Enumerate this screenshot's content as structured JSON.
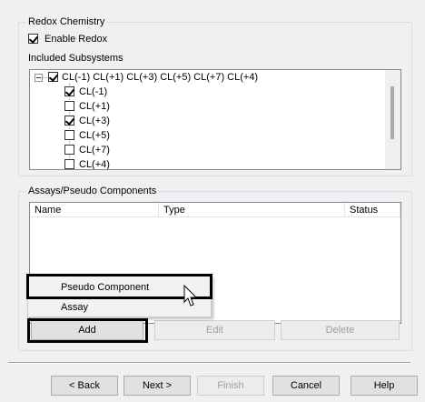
{
  "redox": {
    "group_title": "Redox Chemistry",
    "enable_label": "Enable Redox",
    "enable_checked": true,
    "included_label": "Included Subsystems",
    "tree": {
      "root_label": "CL(-1) CL(+1) CL(+3) CL(+5) CL(+7) CL(+4)",
      "root_checked": true,
      "children": [
        {
          "label": "CL(-1)",
          "checked": true
        },
        {
          "label": "CL(+1)",
          "checked": false
        },
        {
          "label": "CL(+3)",
          "checked": true
        },
        {
          "label": "CL(+5)",
          "checked": false
        },
        {
          "label": "CL(+7)",
          "checked": false
        },
        {
          "label": "CL(+4)",
          "checked": false
        }
      ]
    }
  },
  "assays": {
    "group_title": "Assays/Pseudo Components",
    "columns": [
      "Name",
      "Type",
      "Status"
    ]
  },
  "context_menu": {
    "items": [
      "Pseudo Component",
      "Assay"
    ]
  },
  "buttons": {
    "add": "Add",
    "edit": "Edit",
    "delete": "Delete"
  },
  "wizard": {
    "back": "< Back",
    "next": "Next >",
    "finish": "Finish",
    "cancel": "Cancel",
    "help": "Help"
  }
}
